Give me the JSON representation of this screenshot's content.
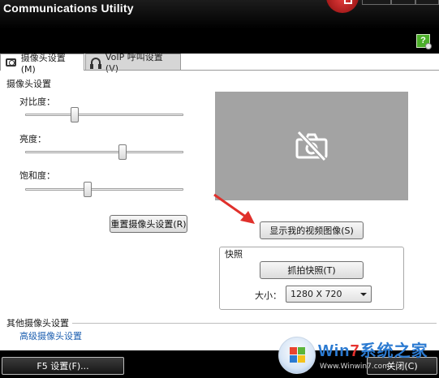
{
  "window": {
    "title": "Communications Utility"
  },
  "help": {
    "label": "?"
  },
  "tabs": [
    {
      "label": "摄像头设置(M)",
      "icon": "camera-icon",
      "active": true
    },
    {
      "label": "VoIP 呼叫设置(V)",
      "icon": "headset-icon",
      "active": false
    }
  ],
  "camera_settings": {
    "heading": "摄像头设置",
    "sliders": [
      {
        "label": "对比度：",
        "value": 0.31
      },
      {
        "label": "亮度：",
        "value": 0.61
      },
      {
        "label": "饱和度：",
        "value": 0.41
      }
    ],
    "reset_label": "重置摄像头设置(R)"
  },
  "preview": {
    "state_icon": "camera-off-icon",
    "show_video_label": "显示我的视频图像(S)"
  },
  "snapshot": {
    "legend": "快照",
    "capture_label": "抓拍快照(T)",
    "size_label": "大小：",
    "size_value": "1280 X 720"
  },
  "other": {
    "heading": "其他摄像头设置",
    "advanced_link": "高级摄像头设置"
  },
  "footer": {
    "f5_label": "F5 设置(F)...",
    "close_label": "关闭(C)"
  },
  "watermark": {
    "text_prefix": "Win",
    "text_seven": "7",
    "text_suffix": "系统之家",
    "url": "Www.Winwin7.com"
  },
  "colors": {
    "titlebar": "#000000",
    "preview_bg": "#a3a3a3",
    "link": "#1d5fb0",
    "annotation_arrow": "#e0302b"
  }
}
